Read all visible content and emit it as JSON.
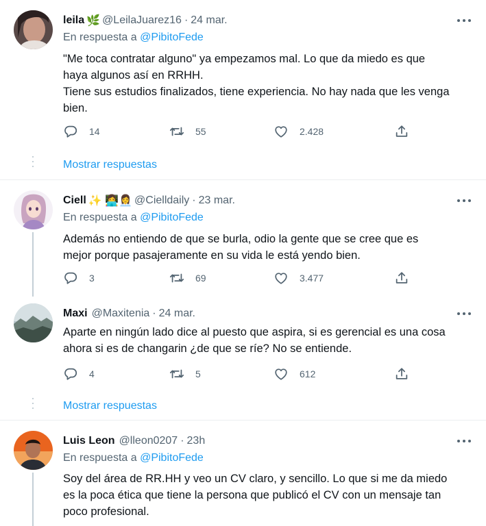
{
  "tweets": [
    {
      "name": "leila",
      "name_emoji": "🌿",
      "handle": "@LeilaJuarez16",
      "date": "24 mar.",
      "reply_label": "En respuesta a",
      "reply_to": "@PibitoFede",
      "lines": [
        "\"Me toca contratar alguno\" ya empezamos mal. Lo que da miedo es que",
        "haya algunos así en RRHH.",
        "Tiene sus estudios finalizados, tiene experiencia. No hay nada que les venga",
        "bien."
      ],
      "replies": "14",
      "retweets": "55",
      "likes": "2.428",
      "show_replies": "Mostrar respuestas"
    },
    {
      "name": "Ciell",
      "name_emoji": "✨ 👩‍💻👩‍💼",
      "handle": "@Cielldaily",
      "date": "23 mar.",
      "reply_label": "En respuesta a",
      "reply_to": "@PibitoFede",
      "lines": [
        "Además no entiendo de que se burla, odio la gente que se cree que es",
        "mejor porque pasajeramente en su vida le está yendo bien."
      ],
      "replies": "3",
      "retweets": "69",
      "likes": "3.477"
    },
    {
      "name": "Maxi",
      "handle": "@Maxitenia",
      "date": "24 mar.",
      "lines": [
        "Aparte en ningún lado dice al puesto que aspira, si es gerencial es una cosa",
        "ahora si es de changarin ¿de que se ríe? No se entiende."
      ],
      "replies": "4",
      "retweets": "5",
      "likes": "612",
      "show_replies": "Mostrar respuestas"
    },
    {
      "name": "Luis Leon",
      "handle": "@lleon0207",
      "date": "23h",
      "reply_label": "En respuesta a",
      "reply_to": "@PibitoFede",
      "lines": [
        "Soy del área de RR.HH y veo un CV claro, y sencillo. Lo que si me da miedo",
        "es la poca ética que tiene la persona que publicó el CV con un mensaje tan",
        "poco profesional."
      ]
    }
  ],
  "colors": {
    "link": "#1d9bf0",
    "secondary_text": "#536471",
    "divider": "#ebeef0"
  },
  "icons": [
    "reply-icon",
    "retweet-icon",
    "like-icon",
    "share-icon",
    "more-icon"
  ]
}
